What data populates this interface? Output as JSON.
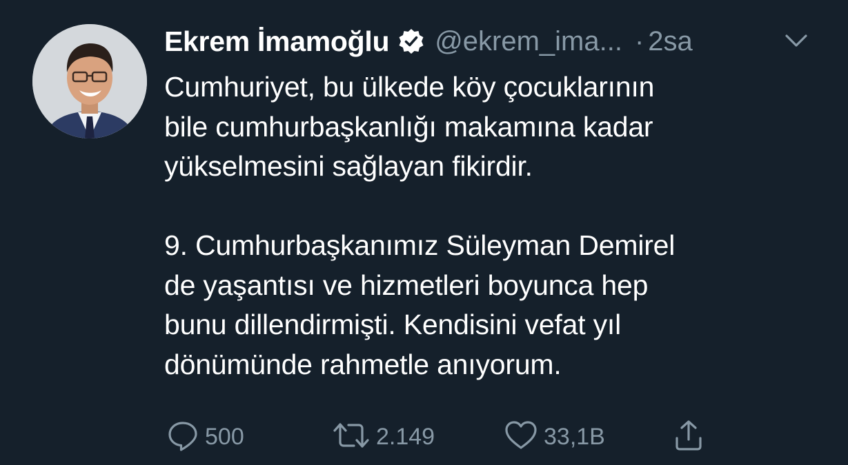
{
  "tweet": {
    "author": {
      "display_name": "Ekrem İmamoğlu",
      "verified": true,
      "handle": "@ekrem_ima...",
      "avatar_icon": "profile-photo"
    },
    "separator": "·",
    "time": "2sa",
    "menu_icon": "chevron-down-icon",
    "text": "Cumhuriyet, bu ülkede köy çocuklarının\nbile cumhurbaşkanlığı makamına kadar\nyükselmesini sağlayan fikirdir.\n\n9. Cumhurbaşkanımız Süleyman Demirel\nde yaşantısı ve hizmetleri boyunca hep\nbunu dillendirmişti. Kendisini vefat yıl\ndönümünde rahmetle anıyorum.",
    "actions": {
      "reply": {
        "icon": "reply-icon",
        "count": "500"
      },
      "retweet": {
        "icon": "retweet-icon",
        "count": "2.149"
      },
      "like": {
        "icon": "heart-icon",
        "count": "33,1B"
      },
      "share": {
        "icon": "share-icon",
        "count": ""
      }
    }
  },
  "colors": {
    "background": "#15202b",
    "primary_text": "#ffffff",
    "secondary_text": "#8899a6"
  }
}
